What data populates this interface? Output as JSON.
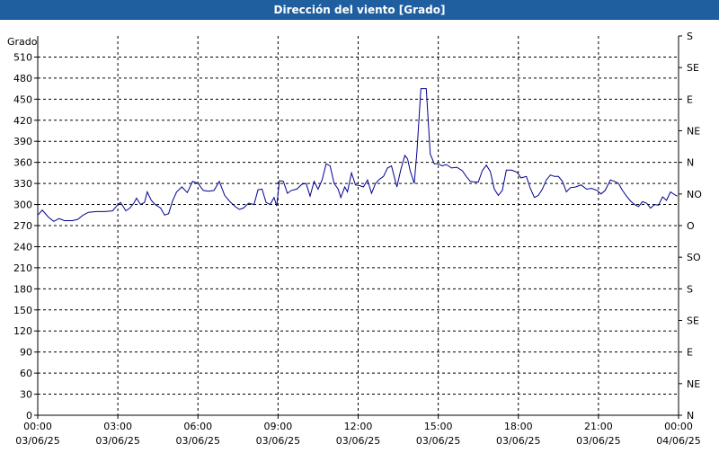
{
  "header": {
    "title": "Dirección del viento [Grado]"
  },
  "colors": {
    "title_bar": "#1f5fa0",
    "series": "#00008b",
    "grid": "#000000"
  },
  "chart_data": {
    "type": "line",
    "title": "Dirección del viento [Grado]",
    "ylabel": "Grado",
    "ylim": [
      0,
      540
    ],
    "yticks": [
      0,
      30,
      60,
      90,
      120,
      150,
      180,
      210,
      240,
      270,
      300,
      330,
      360,
      390,
      420,
      450,
      480,
      510
    ],
    "y2_ticks": [
      {
        "value": 0,
        "label": "N"
      },
      {
        "value": 45,
        "label": "NE"
      },
      {
        "value": 90,
        "label": "E"
      },
      {
        "value": 135,
        "label": "SE"
      },
      {
        "value": 180,
        "label": "S"
      },
      {
        "value": 225,
        "label": "SO"
      },
      {
        "value": 270,
        "label": "O"
      },
      {
        "value": 315,
        "label": "NO"
      },
      {
        "value": 360,
        "label": "N"
      },
      {
        "value": 405,
        "label": "NE"
      },
      {
        "value": 450,
        "label": "E"
      },
      {
        "value": 495,
        "label": "SE"
      },
      {
        "value": 540,
        "label": "S"
      }
    ],
    "xlim_hours": [
      0,
      24
    ],
    "xticks": [
      {
        "hour": 0,
        "time": "00:00",
        "date": "03/06/25"
      },
      {
        "hour": 3,
        "time": "03:00",
        "date": "03/06/25"
      },
      {
        "hour": 6,
        "time": "06:00",
        "date": "03/06/25"
      },
      {
        "hour": 9,
        "time": "09:00",
        "date": "03/06/25"
      },
      {
        "hour": 12,
        "time": "12:00",
        "date": "03/06/25"
      },
      {
        "hour": 15,
        "time": "15:00",
        "date": "03/06/25"
      },
      {
        "hour": 18,
        "time": "18:00",
        "date": "03/06/25"
      },
      {
        "hour": 21,
        "time": "21:00",
        "date": "03/06/25"
      },
      {
        "hour": 24,
        "time": "00:00",
        "date": "04/06/25"
      }
    ],
    "grid": true,
    "series": [
      {
        "values": [
          [
            0.0,
            285
          ],
          [
            0.17,
            292
          ],
          [
            0.4,
            282
          ],
          [
            0.6,
            276
          ],
          [
            0.8,
            280
          ],
          [
            1.0,
            277
          ],
          [
            1.3,
            277
          ],
          [
            1.5,
            279
          ],
          [
            1.7,
            285
          ],
          [
            1.9,
            289
          ],
          [
            2.2,
            290
          ],
          [
            2.5,
            290
          ],
          [
            2.8,
            291
          ],
          [
            3.0,
            300
          ],
          [
            3.1,
            303
          ],
          [
            3.2,
            297
          ],
          [
            3.3,
            291
          ],
          [
            3.45,
            295
          ],
          [
            3.6,
            302
          ],
          [
            3.7,
            309
          ],
          [
            3.85,
            300
          ],
          [
            4.0,
            303
          ],
          [
            4.1,
            318
          ],
          [
            4.25,
            306
          ],
          [
            4.4,
            300
          ],
          [
            4.6,
            295
          ],
          [
            4.75,
            285
          ],
          [
            4.9,
            287
          ],
          [
            5.05,
            305
          ],
          [
            5.2,
            318
          ],
          [
            5.4,
            325
          ],
          [
            5.6,
            317
          ],
          [
            5.8,
            333
          ],
          [
            6.0,
            330
          ],
          [
            6.2,
            320
          ],
          [
            6.4,
            319
          ],
          [
            6.6,
            320
          ],
          [
            6.8,
            333
          ],
          [
            7.0,
            313
          ],
          [
            7.2,
            304
          ],
          [
            7.4,
            297
          ],
          [
            7.55,
            293
          ],
          [
            7.7,
            295
          ],
          [
            7.9,
            302
          ],
          [
            8.1,
            300
          ],
          [
            8.25,
            321
          ],
          [
            8.4,
            322
          ],
          [
            8.55,
            303
          ],
          [
            8.7,
            300
          ],
          [
            8.85,
            310
          ],
          [
            8.95,
            298
          ],
          [
            9.05,
            334
          ],
          [
            9.2,
            333
          ],
          [
            9.35,
            316
          ],
          [
            9.5,
            320
          ],
          [
            9.7,
            322
          ],
          [
            9.9,
            329
          ],
          [
            10.05,
            330
          ],
          [
            10.2,
            312
          ],
          [
            10.35,
            333
          ],
          [
            10.5,
            322
          ],
          [
            10.65,
            335
          ],
          [
            10.8,
            358
          ],
          [
            10.95,
            355
          ],
          [
            11.1,
            330
          ],
          [
            11.25,
            322
          ],
          [
            11.35,
            310
          ],
          [
            11.5,
            325
          ],
          [
            11.6,
            318
          ],
          [
            11.75,
            345
          ],
          [
            11.9,
            328
          ],
          [
            12.05,
            327
          ],
          [
            12.2,
            325
          ],
          [
            12.35,
            335
          ],
          [
            12.5,
            316
          ],
          [
            12.65,
            330
          ],
          [
            12.8,
            336
          ],
          [
            12.95,
            340
          ],
          [
            13.1,
            352
          ],
          [
            13.25,
            355
          ],
          [
            13.45,
            325
          ],
          [
            13.6,
            350
          ],
          [
            13.75,
            370
          ],
          [
            13.85,
            365
          ],
          [
            13.95,
            348
          ],
          [
            14.1,
            330
          ],
          [
            14.2,
            375
          ],
          [
            14.35,
            465
          ],
          [
            14.55,
            465
          ],
          [
            14.7,
            372
          ],
          [
            14.85,
            358
          ],
          [
            15.0,
            358
          ],
          [
            15.15,
            355
          ],
          [
            15.3,
            357
          ],
          [
            15.5,
            352
          ],
          [
            15.7,
            353
          ],
          [
            15.9,
            348
          ],
          [
            16.05,
            340
          ],
          [
            16.2,
            333
          ],
          [
            16.35,
            332
          ],
          [
            16.5,
            332
          ],
          [
            16.65,
            348
          ],
          [
            16.8,
            356
          ],
          [
            16.95,
            347
          ],
          [
            17.1,
            322
          ],
          [
            17.25,
            313
          ],
          [
            17.4,
            320
          ],
          [
            17.55,
            349
          ],
          [
            17.75,
            349
          ],
          [
            17.95,
            346
          ],
          [
            18.1,
            338
          ],
          [
            18.3,
            340
          ],
          [
            18.45,
            323
          ],
          [
            18.6,
            310
          ],
          [
            18.75,
            313
          ],
          [
            18.9,
            322
          ],
          [
            19.05,
            335
          ],
          [
            19.2,
            342
          ],
          [
            19.35,
            340
          ],
          [
            19.5,
            340
          ],
          [
            19.65,
            333
          ],
          [
            19.8,
            318
          ],
          [
            19.95,
            324
          ],
          [
            20.15,
            325
          ],
          [
            20.35,
            328
          ],
          [
            20.55,
            322
          ],
          [
            20.75,
            323
          ],
          [
            20.95,
            320
          ],
          [
            21.1,
            315
          ],
          [
            21.25,
            320
          ],
          [
            21.45,
            335
          ],
          [
            21.6,
            333
          ],
          [
            21.75,
            330
          ],
          [
            21.9,
            320
          ],
          [
            22.05,
            312
          ],
          [
            22.2,
            305
          ],
          [
            22.35,
            300
          ],
          [
            22.5,
            297
          ],
          [
            22.65,
            304
          ],
          [
            22.8,
            302
          ],
          [
            22.95,
            295
          ],
          [
            23.1,
            300
          ],
          [
            23.25,
            299
          ],
          [
            23.4,
            311
          ],
          [
            23.55,
            306
          ],
          [
            23.7,
            318
          ],
          [
            23.85,
            314
          ],
          [
            23.95,
            312
          ]
        ]
      }
    ]
  }
}
